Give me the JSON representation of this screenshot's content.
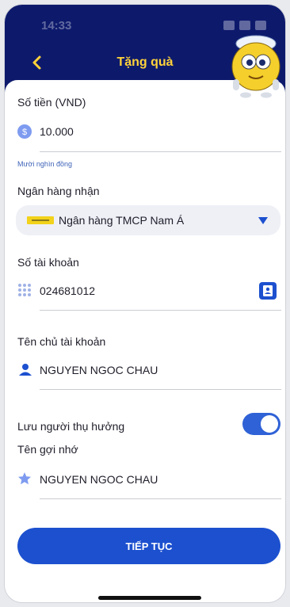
{
  "status": {
    "time": "14:33"
  },
  "header": {
    "title": "Tặng quà"
  },
  "form": {
    "amount": {
      "label": "Số tiền (VND)",
      "value": "10.000",
      "in_words": "Mười nghìn đồng"
    },
    "bank": {
      "label": "Ngân hàng nhận",
      "value": "Ngân hàng TMCP Nam Á"
    },
    "account_number": {
      "label": "Số tài khoản",
      "value": "024681012"
    },
    "account_name": {
      "label": "Tên chủ tài khoản",
      "value": "NGUYEN NGOC CHAU"
    },
    "save_recipient": {
      "label": "Lưu người thụ hưởng",
      "enabled": true
    },
    "nickname": {
      "label": "Tên gợi nhớ",
      "value": "NGUYEN NGOC CHAU"
    }
  },
  "continue_label": "TIẾP TỤC",
  "colors": {
    "header_bg": "#0d1a6c",
    "title": "#ffd33a",
    "primary": "#1c50cf",
    "toggle_on": "#2f62d6"
  },
  "icons": [
    "chevron-left-icon",
    "coin-icon",
    "bank-logo-icon",
    "caret-down-icon",
    "keypad-icon",
    "contact-book-icon",
    "user-icon",
    "star-icon",
    "mascot-icon"
  ]
}
